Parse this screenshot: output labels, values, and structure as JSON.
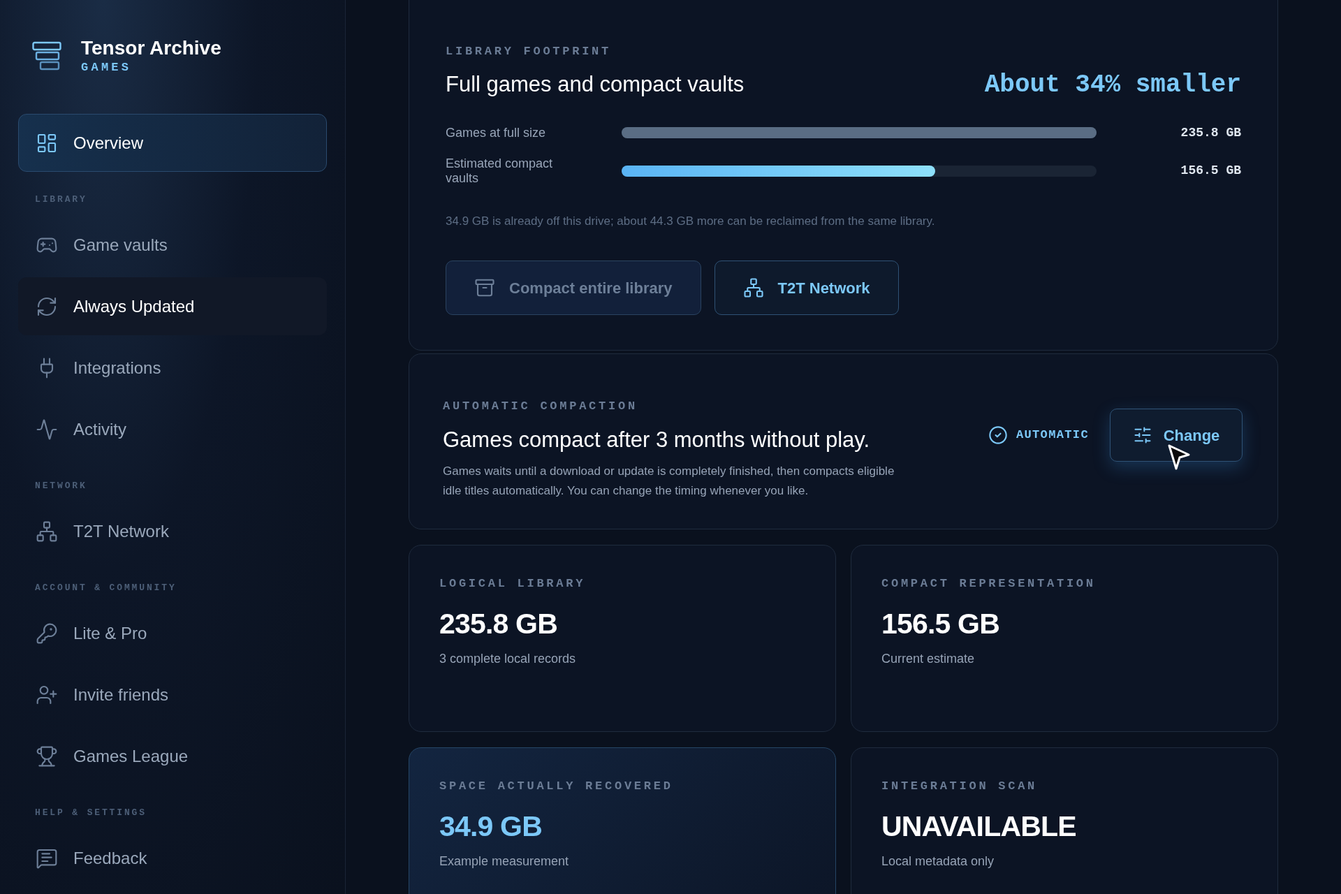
{
  "sidebar": {
    "brand": {
      "name": "Tensor Archive",
      "subtitle": "GAMES"
    },
    "sections": [
      {
        "items": [
          {
            "label": "Overview",
            "selected": true,
            "highlighted": false
          }
        ]
      },
      {
        "heading": "LIBRARY",
        "items": [
          {
            "label": "Game vaults",
            "selected": false,
            "highlighted": false
          },
          {
            "label": "Always Updated",
            "selected": false,
            "highlighted": true
          },
          {
            "label": "Integrations",
            "selected": false,
            "highlighted": false
          },
          {
            "label": "Activity",
            "selected": false,
            "highlighted": false
          }
        ]
      },
      {
        "heading": "NETWORK",
        "items": [
          {
            "label": "T2T Network",
            "selected": false,
            "highlighted": false
          }
        ]
      },
      {
        "heading": "ACCOUNT & COMMUNITY",
        "items": [
          {
            "label": "Lite & Pro",
            "selected": false,
            "highlighted": false
          },
          {
            "label": "Invite friends",
            "selected": false,
            "highlighted": false
          },
          {
            "label": "Games League",
            "selected": false,
            "highlighted": false
          }
        ]
      },
      {
        "heading": "HELP & SETTINGS",
        "items": [
          {
            "label": "Feedback",
            "selected": false,
            "highlighted": false
          }
        ]
      }
    ]
  },
  "footprint": {
    "eyebrow": "LIBRARY FOOTPRINT",
    "title": "Full games and compact vaults",
    "summary": "About 34% smaller",
    "bars": [
      {
        "kind": "full",
        "label": "Games at full size",
        "level": 1,
        "value": "235.8 GB"
      },
      {
        "kind": "compact",
        "label": "Estimated compact vaults",
        "level": 0.66,
        "value": "156.5 GB"
      }
    ],
    "note": "34.9 GB is already off this drive; about 44.3 GB more can be reclaimed from the same library.",
    "buttons": [
      {
        "label": "Compact entire library",
        "disabled": true
      },
      {
        "label": "T2T Network",
        "disabled": false
      }
    ]
  },
  "automation": {
    "eyebrow": "AUTOMATIC COMPACTION",
    "title": "Games compact after 3 months without play.",
    "description": "Games waits until a download or update is completely finished, then compacts eligible idle titles automatically. You can change the timing whenever you like.",
    "status": "AUTOMATIC",
    "button": "Change"
  },
  "stats": [
    {
      "label": "LOGICAL LIBRARY",
      "value": "235.8 GB",
      "caption": "3 complete local records",
      "highlighted": false
    },
    {
      "label": "COMPACT REPRESENTATION",
      "value": "156.5 GB",
      "caption": "Current estimate",
      "highlighted": false
    },
    {
      "label": "SPACE ACTUALLY RECOVERED",
      "value": "34.9 GB",
      "caption": "Example measurement",
      "highlighted": true
    },
    {
      "label": "INTEGRATION SCAN",
      "value": "UNAVAILABLE",
      "caption": "Local metadata only",
      "highlighted": false
    }
  ]
}
